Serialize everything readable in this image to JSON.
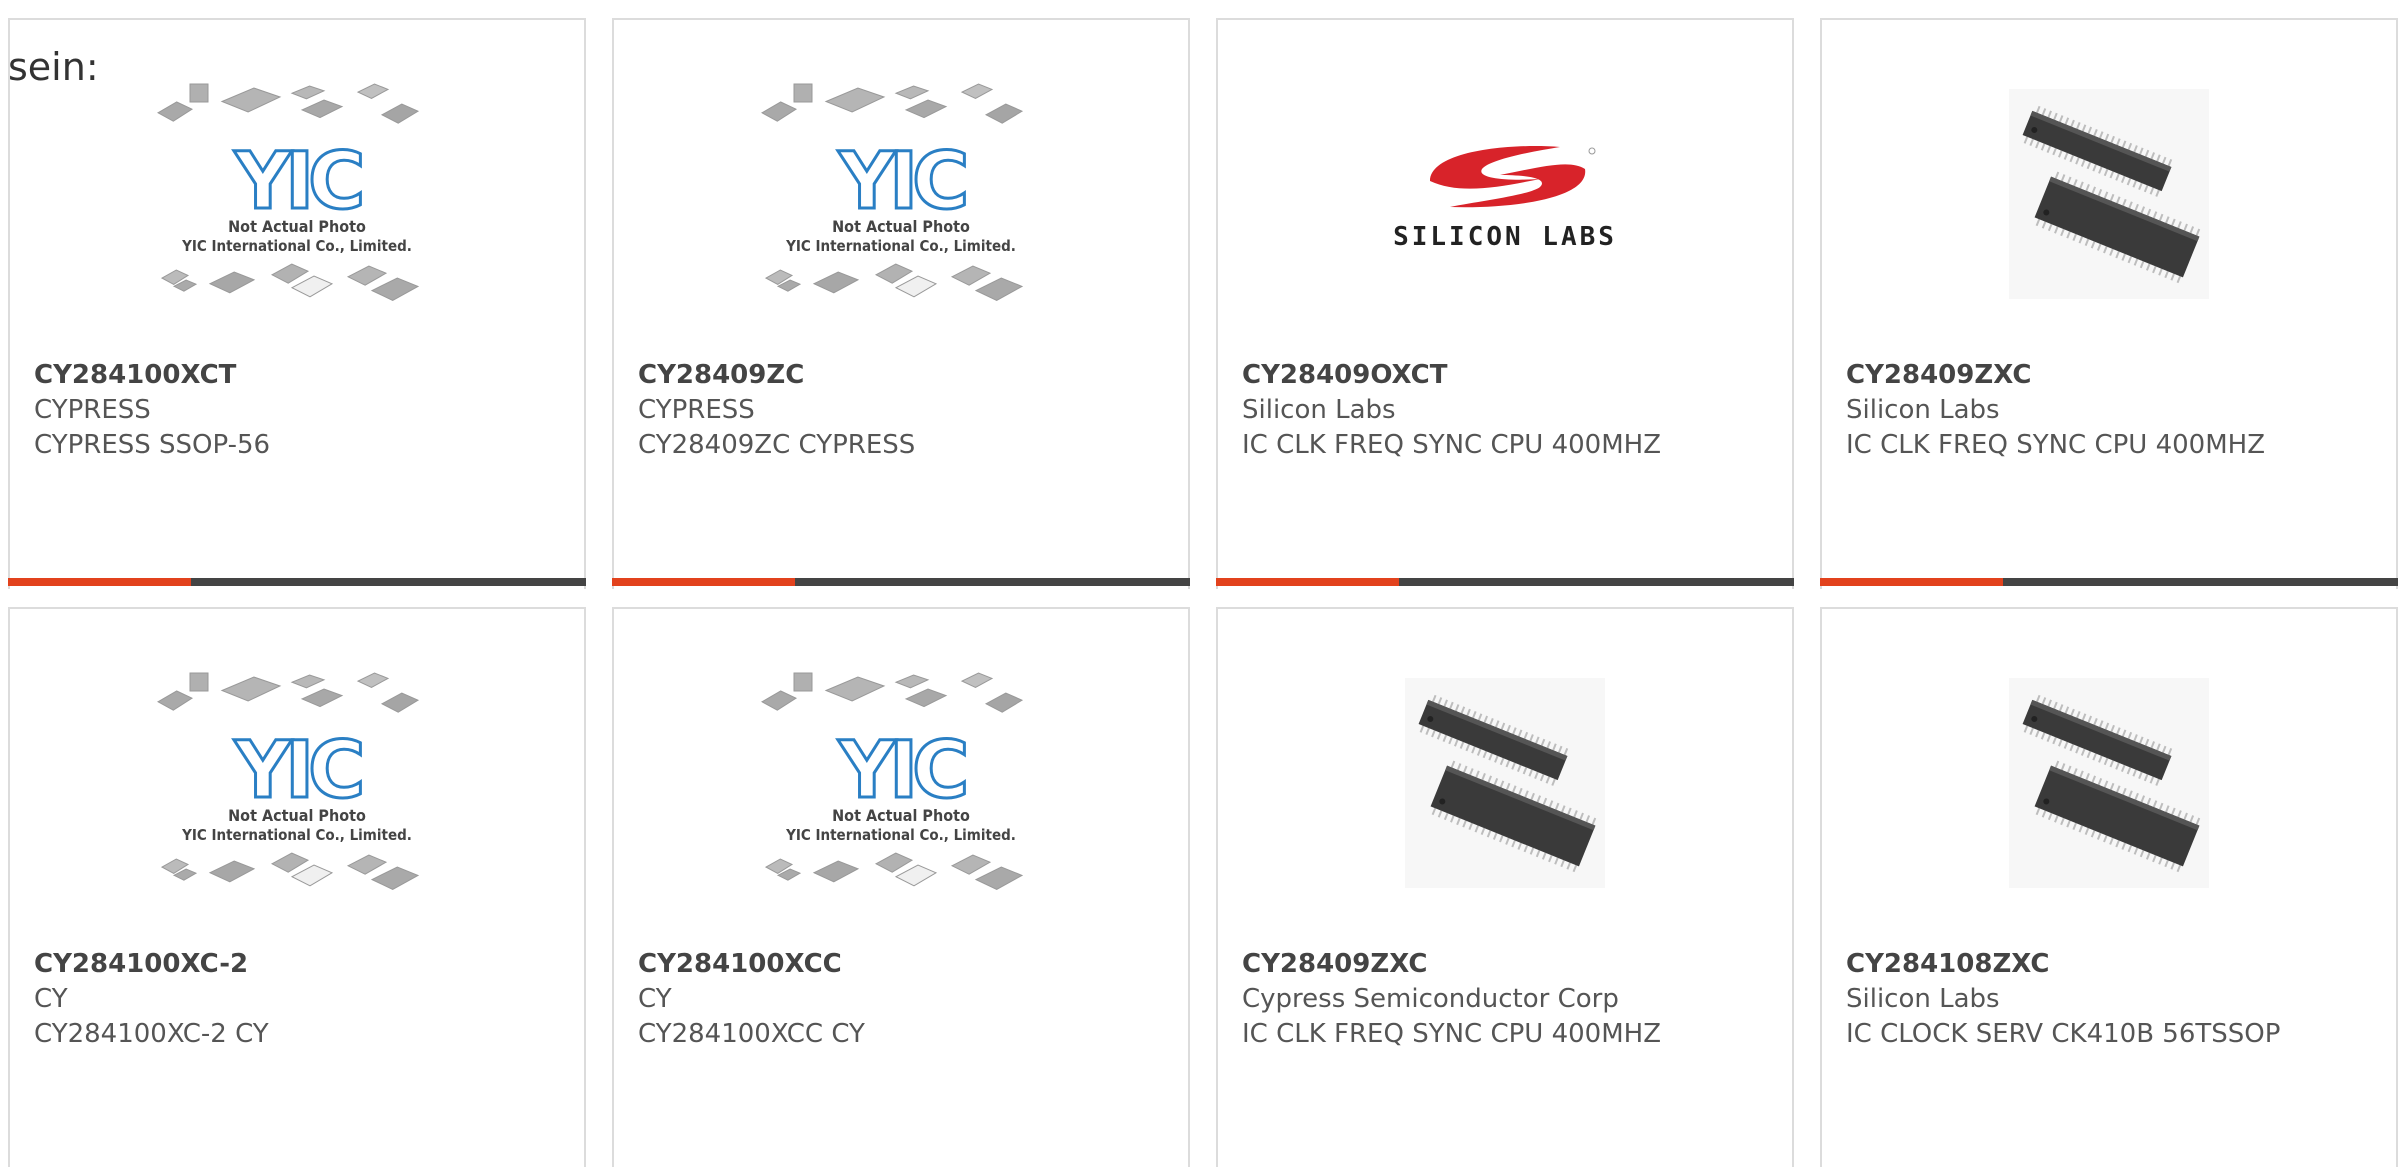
{
  "lead_text": "sein:",
  "colors": {
    "accent": "#e2421d",
    "bar": "#444444",
    "border": "#dcdcdc",
    "yic_blue": "#2a7fc4",
    "silicon_red": "#d8232a"
  },
  "placeholder": {
    "caption_line1": "Not Actual Photo",
    "caption_line2": "YIC International Co., Limited.",
    "logo_text": "YIC"
  },
  "silicon_logo": {
    "text": "SILICON LABS"
  },
  "products": [
    {
      "part": "CY284100XCT",
      "manufacturer": "CYPRESS",
      "description": "CYPRESS SSOP-56",
      "image": "yic-placeholder"
    },
    {
      "part": "CY28409ZC",
      "manufacturer": "CYPRESS",
      "description": "CY28409ZC CYPRESS",
      "image": "yic-placeholder"
    },
    {
      "part": "CY28409OXCT",
      "manufacturer": "Silicon Labs",
      "description": "IC CLK FREQ SYNC CPU 400MHZ",
      "image": "silicon-labs-logo"
    },
    {
      "part": "CY28409ZXC",
      "manufacturer": "Silicon Labs",
      "description": "IC CLK FREQ SYNC CPU 400MHZ",
      "image": "tssop-chips"
    },
    {
      "part": "CY284100XC-2",
      "manufacturer": "CY",
      "description": "CY284100XC-2 CY",
      "image": "yic-placeholder"
    },
    {
      "part": "CY284100XCC",
      "manufacturer": "CY",
      "description": "CY284100XCC CY",
      "image": "yic-placeholder"
    },
    {
      "part": "CY28409ZXC",
      "manufacturer": "Cypress Semiconductor Corp",
      "description": "IC CLK FREQ SYNC CPU 400MHZ",
      "image": "tssop-chips"
    },
    {
      "part": "CY284108ZXC",
      "manufacturer": "Silicon Labs",
      "description": "IC CLOCK SERV CK410B 56TSSOP",
      "image": "tssop-chips"
    }
  ]
}
